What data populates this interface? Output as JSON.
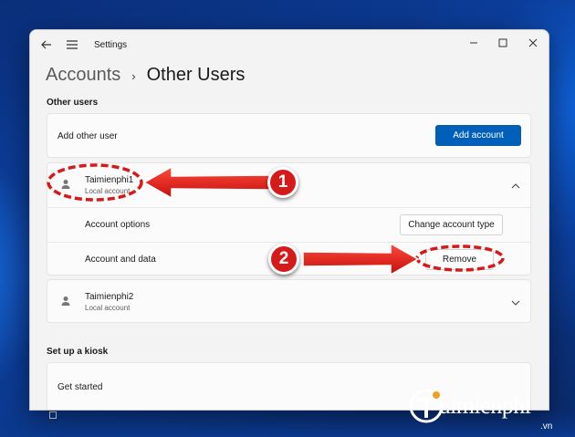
{
  "window": {
    "title": "Settings"
  },
  "breadcrumb": {
    "parent": "Accounts",
    "separator": "›",
    "current": "Other Users"
  },
  "other_users": {
    "section_label": "Other users",
    "add_other_user_label": "Add other user",
    "add_account_button": "Add account",
    "users": [
      {
        "name": "Taimienphi1",
        "type": "Local account",
        "expanded": true,
        "options": [
          {
            "label": "Account options",
            "button": "Change account type"
          },
          {
            "label": "Account and data",
            "button": "Remove"
          }
        ]
      },
      {
        "name": "Taimienphi2",
        "type": "Local account",
        "expanded": false
      }
    ]
  },
  "kiosk": {
    "section_label": "Set up a kiosk",
    "get_started_label": "Get started"
  },
  "annotations": {
    "step1": "1",
    "step2": "2",
    "color": "#d61a1a"
  },
  "watermark": {
    "brand": "aimienphi",
    "domain": ".vn"
  },
  "colors": {
    "accent": "#005fb8",
    "window_bg": "#f3f3f3",
    "card_bg": "#fbfbfb"
  }
}
